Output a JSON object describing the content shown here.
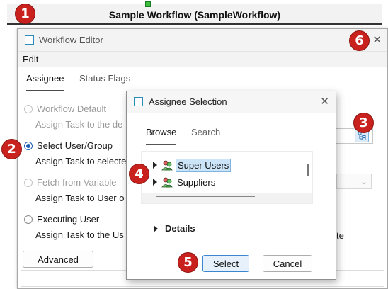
{
  "workflow": {
    "title": "Sample Workflow (SampleWorkflow)"
  },
  "editor": {
    "title": "Workflow Editor",
    "menu": [
      "Edit"
    ],
    "tabs": [
      "Assignee",
      "Status Flags"
    ],
    "options": [
      {
        "label": "Workflow Default",
        "desc": "Assign Task to the de",
        "enabled": false,
        "checked": false
      },
      {
        "label": "Select User/Group",
        "desc": "Assign Task to selecte",
        "enabled": true,
        "checked": true
      },
      {
        "label": "Fetch from Variable",
        "desc": "Assign Task to User o",
        "enabled": false,
        "checked": false
      },
      {
        "label": "Executing User",
        "desc": "Assign Task to the Us",
        "enabled": true,
        "checked": false
      }
    ],
    "trailing_text": "te",
    "advanced_label": "Advanced"
  },
  "dialog": {
    "title": "Assignee Selection",
    "tabs": [
      "Browse",
      "Search"
    ],
    "tree": [
      {
        "label": "Super Users",
        "selected": true
      },
      {
        "label": "Suppliers",
        "selected": false
      }
    ],
    "details_label": "Details",
    "select_label": "Select",
    "cancel_label": "Cancel"
  },
  "markers": [
    "1",
    "2",
    "3",
    "4",
    "5",
    "6"
  ],
  "icons": {
    "close": "close-icon",
    "picker": "user-group-picker-icon",
    "group": "user-group-icon",
    "window": "window-icon"
  },
  "colors": {
    "marker": "#c9211e",
    "selection": "#cce4f7",
    "accent": "#1a5fb4",
    "node_handle": "#3cbf3c"
  }
}
